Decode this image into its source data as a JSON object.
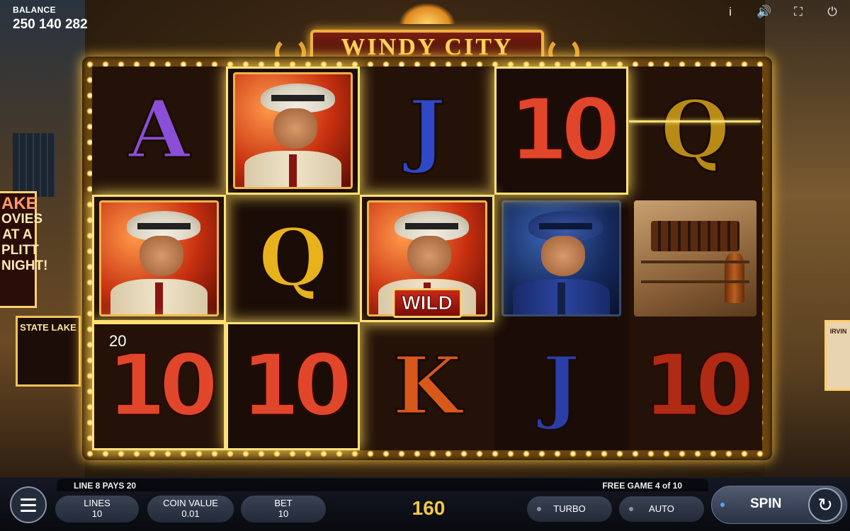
{
  "header": {
    "balance_label": "BALANCE",
    "balance_value": "250 140 282",
    "icons": [
      "info-icon",
      "sound-icon",
      "fullscreen-icon",
      "power-icon"
    ]
  },
  "logo": {
    "title": "WINDY CITY"
  },
  "background": {
    "marquee_top": "AKE",
    "marquee_lines": [
      "OVIES",
      "AT A",
      "PLITT",
      "NIGHT!"
    ],
    "state_lake": "STATE LAKE",
    "right_sign": "IRVIN"
  },
  "reels": {
    "rows": [
      [
        {
          "symbol": "A",
          "kind": "letter",
          "color": "#8a4ed8",
          "win": false
        },
        {
          "symbol": "gangster",
          "kind": "character",
          "win": true
        },
        {
          "symbol": "J",
          "kind": "letter",
          "color": "#2e48c8",
          "win": false
        },
        {
          "symbol": "10",
          "kind": "ten",
          "color": "#e2462a",
          "win": true
        },
        {
          "symbol": "Q",
          "kind": "letter",
          "color": "#b88a16",
          "win": false
        }
      ],
      [
        {
          "symbol": "gangster",
          "kind": "character",
          "win": true
        },
        {
          "symbol": "Q",
          "kind": "letter",
          "color": "#e8b21c",
          "win": false
        },
        {
          "symbol": "gangster-wild",
          "kind": "character",
          "win": true,
          "badge": "WILD"
        },
        {
          "symbol": "detective",
          "kind": "character-blue",
          "win": false
        },
        {
          "symbol": "whiskey-crate",
          "kind": "crate",
          "win": false
        }
      ],
      [
        {
          "symbol": "10",
          "kind": "ten",
          "color": "#e2462a",
          "win": true,
          "amount": "20"
        },
        {
          "symbol": "10",
          "kind": "ten",
          "color": "#e2462a",
          "win": true
        },
        {
          "symbol": "K",
          "kind": "letter",
          "color": "#d8581c",
          "win": false
        },
        {
          "symbol": "J",
          "kind": "letter",
          "color": "#2a3ea8",
          "win": false
        },
        {
          "symbol": "10",
          "kind": "ten",
          "color": "#b02a14",
          "win": false
        }
      ]
    ]
  },
  "status": {
    "line_info": "LINE 8 PAYS 20",
    "free_game": "FREE GAME 4 of 10"
  },
  "controls": {
    "lines_label": "LINES",
    "lines_value": "10",
    "coin_label": "COIN VALUE",
    "coin_value": "0.01",
    "bet_label": "BET",
    "bet_value": "10",
    "win_total": "160",
    "turbo_label": "TURBO",
    "auto_label": "AUTO",
    "spin_label": "SPIN"
  }
}
